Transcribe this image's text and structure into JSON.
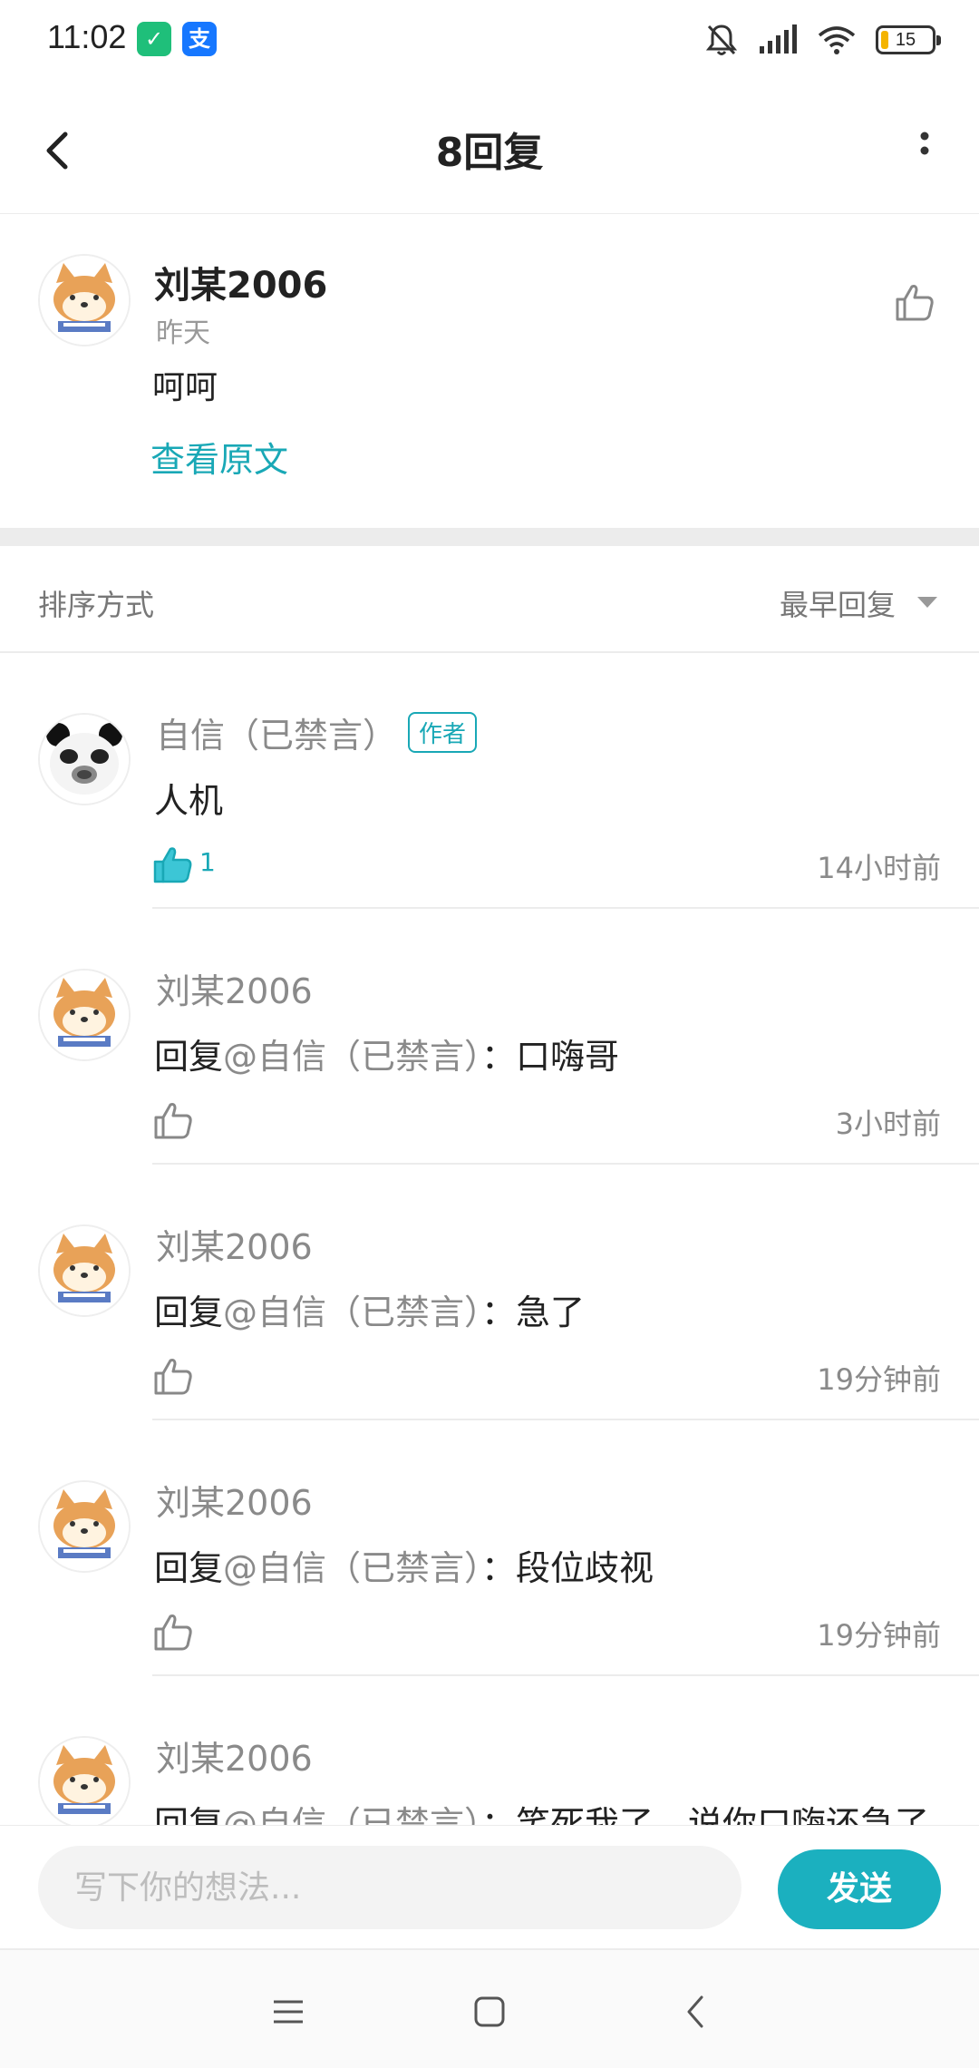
{
  "status_bar": {
    "time": "11:02",
    "battery": "15"
  },
  "header": {
    "title": "8回复"
  },
  "main_comment": {
    "author": "刘某2006",
    "time": "昨天",
    "text": "呵呵",
    "view_original": "查看原文"
  },
  "sort": {
    "label": "排序方式",
    "value": "最早回复"
  },
  "replies": [
    {
      "author": "自信（已禁言）",
      "tag": "作者",
      "text": "人机",
      "likes": "1",
      "time": "14小时前"
    },
    {
      "author": "刘某2006",
      "prefix": "回复",
      "mention": "@自信（已禁言）",
      "text": "：口嗨哥",
      "time": "3小时前"
    },
    {
      "author": "刘某2006",
      "prefix": "回复",
      "mention": "@自信（已禁言）",
      "text": "：急了",
      "time": "19分钟前"
    },
    {
      "author": "刘某2006",
      "prefix": "回复",
      "mention": "@自信（已禁言）",
      "text": "：段位歧视",
      "time": "19分钟前"
    },
    {
      "author": "刘某2006",
      "prefix": "回复",
      "mention": "@自信（已禁言）",
      "text": "：笑死我了，说你口嗨还急了"
    }
  ],
  "composer": {
    "placeholder": "写下你的想法...",
    "send": "发送"
  },
  "colors": {
    "accent": "#19a8b6",
    "send_bg": "#1bb0bf"
  }
}
